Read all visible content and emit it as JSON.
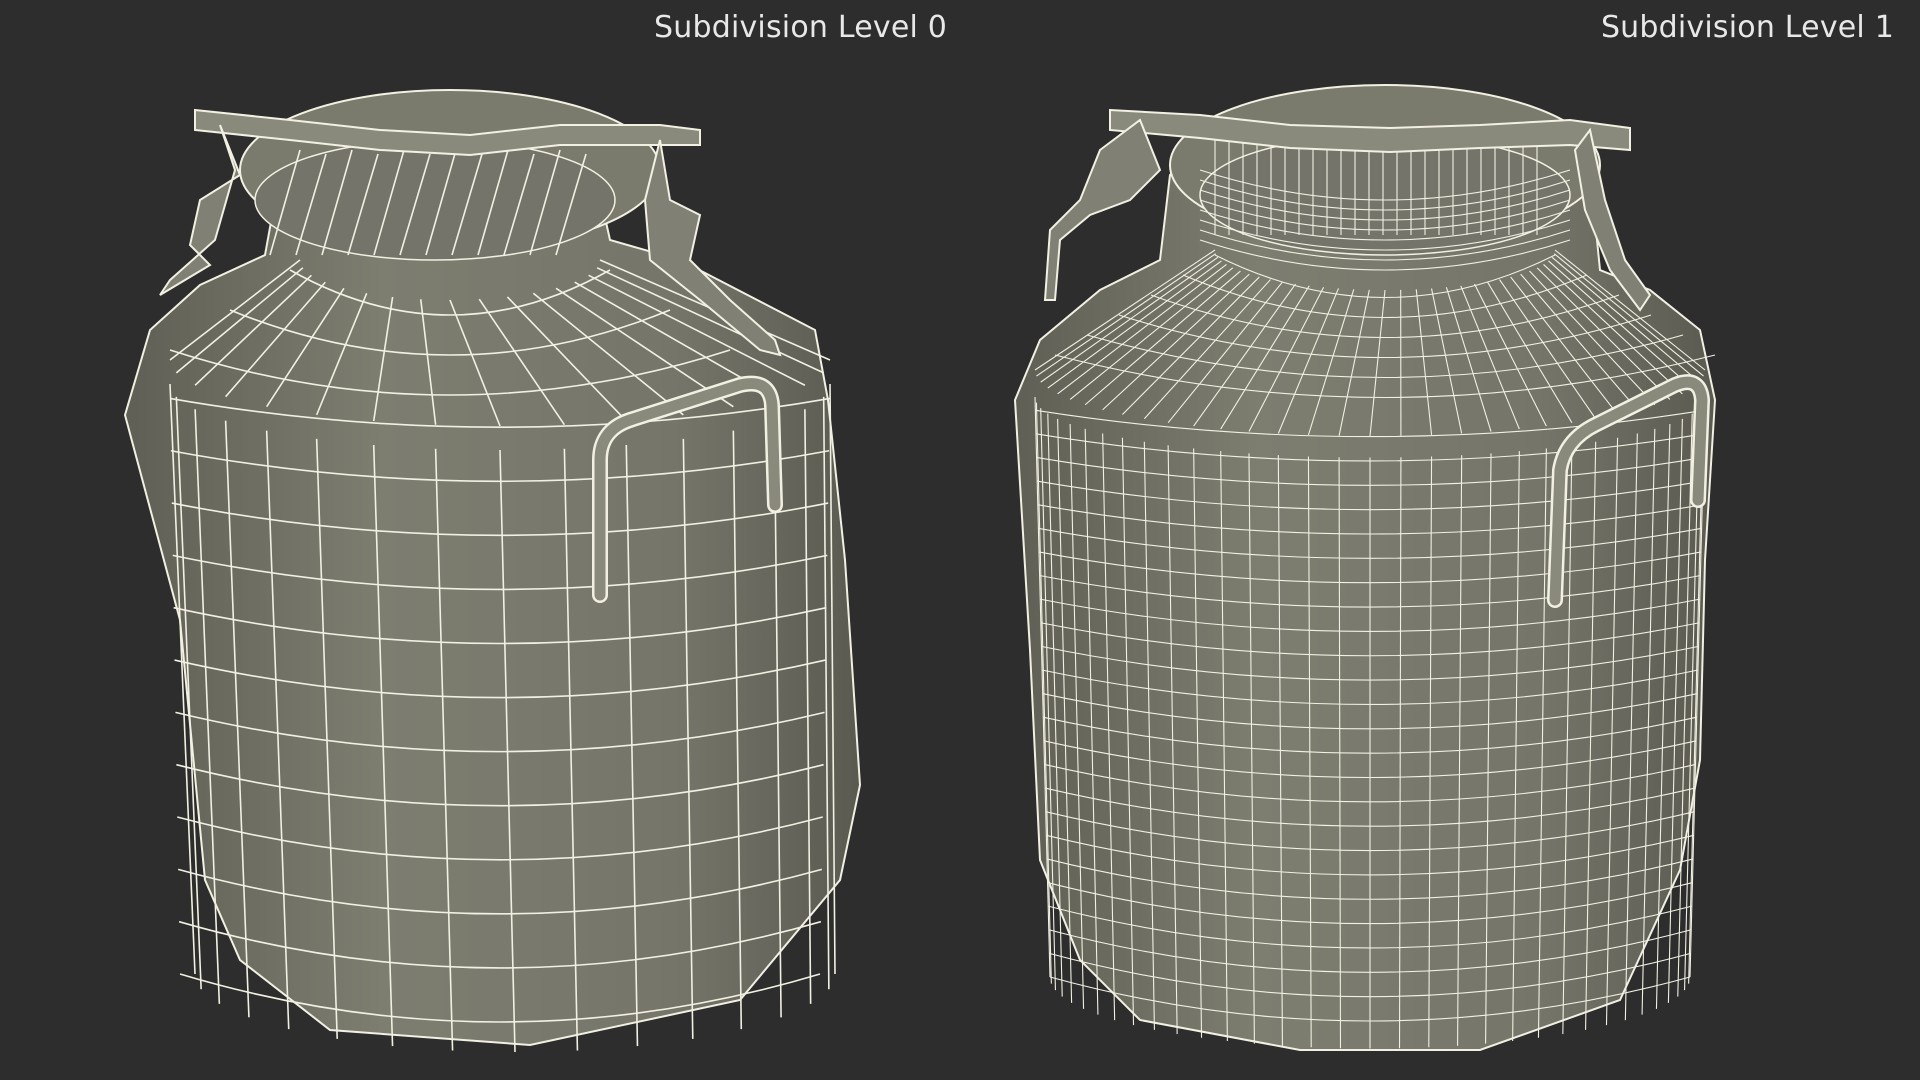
{
  "panels": [
    {
      "label": "Subdivision Level 0"
    },
    {
      "label": "Subdivision Level 1"
    }
  ],
  "colors": {
    "background": "#2d2d2d",
    "surface": "#79796c",
    "surface_shadow": "#5e5e54",
    "wire": "#f2f0e2",
    "text": "#e8e8e8"
  }
}
